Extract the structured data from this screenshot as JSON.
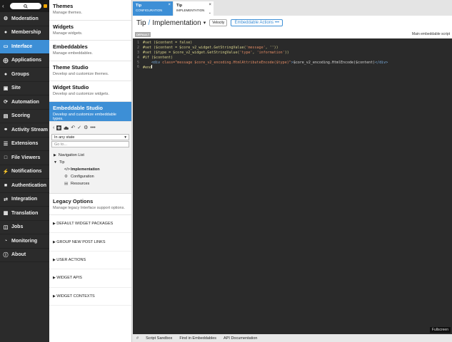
{
  "nav": {
    "items": [
      {
        "label": "Moderation",
        "icon": "gear-icon"
      },
      {
        "label": "Membership",
        "icon": "users-icon"
      },
      {
        "label": "Interface",
        "icon": "window-icon",
        "active": true
      },
      {
        "label": "Applications",
        "icon": "apps-icon"
      },
      {
        "label": "Groups",
        "icon": "groups-icon"
      },
      {
        "label": "Site",
        "icon": "site-icon"
      },
      {
        "label": "Automation",
        "icon": "automation-icon"
      },
      {
        "label": "Scoring",
        "icon": "scoring-icon"
      },
      {
        "label": "Activity Stream",
        "icon": "globe-icon"
      },
      {
        "label": "Extensions",
        "icon": "layers-icon"
      },
      {
        "label": "File Viewers",
        "icon": "file-icon"
      },
      {
        "label": "Notifications",
        "icon": "lightning-icon"
      },
      {
        "label": "Authentication",
        "icon": "lock-icon"
      },
      {
        "label": "Integration",
        "icon": "shuffle-icon"
      },
      {
        "label": "Translation",
        "icon": "translation-icon"
      },
      {
        "label": "Jobs",
        "icon": "database-icon"
      },
      {
        "label": "Monitoring",
        "icon": "dashboard-icon"
      },
      {
        "label": "About",
        "icon": "info-icon"
      }
    ]
  },
  "mid": {
    "items": [
      {
        "title": "Themes",
        "desc": "Manage themes."
      },
      {
        "title": "Widgets",
        "desc": "Manage widgets."
      },
      {
        "title": "Embeddables",
        "desc": "Manage embeddables."
      },
      {
        "title": "Theme Studio",
        "desc": "Develop and customize themes."
      },
      {
        "title": "Widget Studio",
        "desc": "Develop and customize widgets."
      },
      {
        "title": "Embeddable Studio",
        "desc": "Develop and customize embeddable types.",
        "active": true
      }
    ],
    "state_select": "In any state",
    "goto_placeholder": "Go to...",
    "tree": {
      "nav_list": "Navigation List",
      "tip": "Tip",
      "implementation": "Implementation",
      "configuration": "Configuration",
      "resources": "Resources"
    },
    "legacy": {
      "title": "Legacy Options",
      "desc": "Manage legacy Interface support options."
    },
    "sections": [
      "DEFAULT WIDGET PACKAGES",
      "GROUP NEW POST LINKS",
      "USER ACTIONS",
      "WIDGET APIS",
      "WIDGET CONTEXTS"
    ]
  },
  "tabs": [
    {
      "title": "Tip",
      "sub": "CONFIGURATION"
    },
    {
      "title": "Tip",
      "sub": "IMPLEMENTATION"
    }
  ],
  "editor": {
    "crumb1": "Tip",
    "sep": "/",
    "crumb2": "Implementation",
    "lang": "Velocity",
    "actions": "Embeddable Actions",
    "default_badge": "DEFAULT",
    "file_note": "Main embeddable script",
    "line_numbers": [
      "1",
      "2",
      "3",
      "4",
      "5",
      "6"
    ],
    "lines": [
      [
        "#set ($content = false)"
      ],
      [
        "#set ($content = $core_v2_widget.GetStringValue(",
        "'message'",
        ", ''))"
      ],
      [
        "#set ($type = $core_v2_widget.GetStringValue(",
        "'type'",
        ", ",
        "'information'",
        "))"
      ],
      [
        "#if ($content)"
      ],
      [
        "    ",
        "<div ",
        "class=",
        "\"message $core_v2_encoding.HtmlAttributeEncode($type)\"",
        ">",
        "$core_v2_encoding.HtmlEncode($content)",
        "</div>"
      ],
      [
        "#end"
      ]
    ]
  },
  "fullscreen": "Fullscreen",
  "bottom": [
    "#",
    "Script Sandbox",
    "Find in Embeddables",
    "API Documentation"
  ],
  "colors": {
    "accent": "#3d8fd6",
    "nav_bg": "#2b2b2b"
  }
}
